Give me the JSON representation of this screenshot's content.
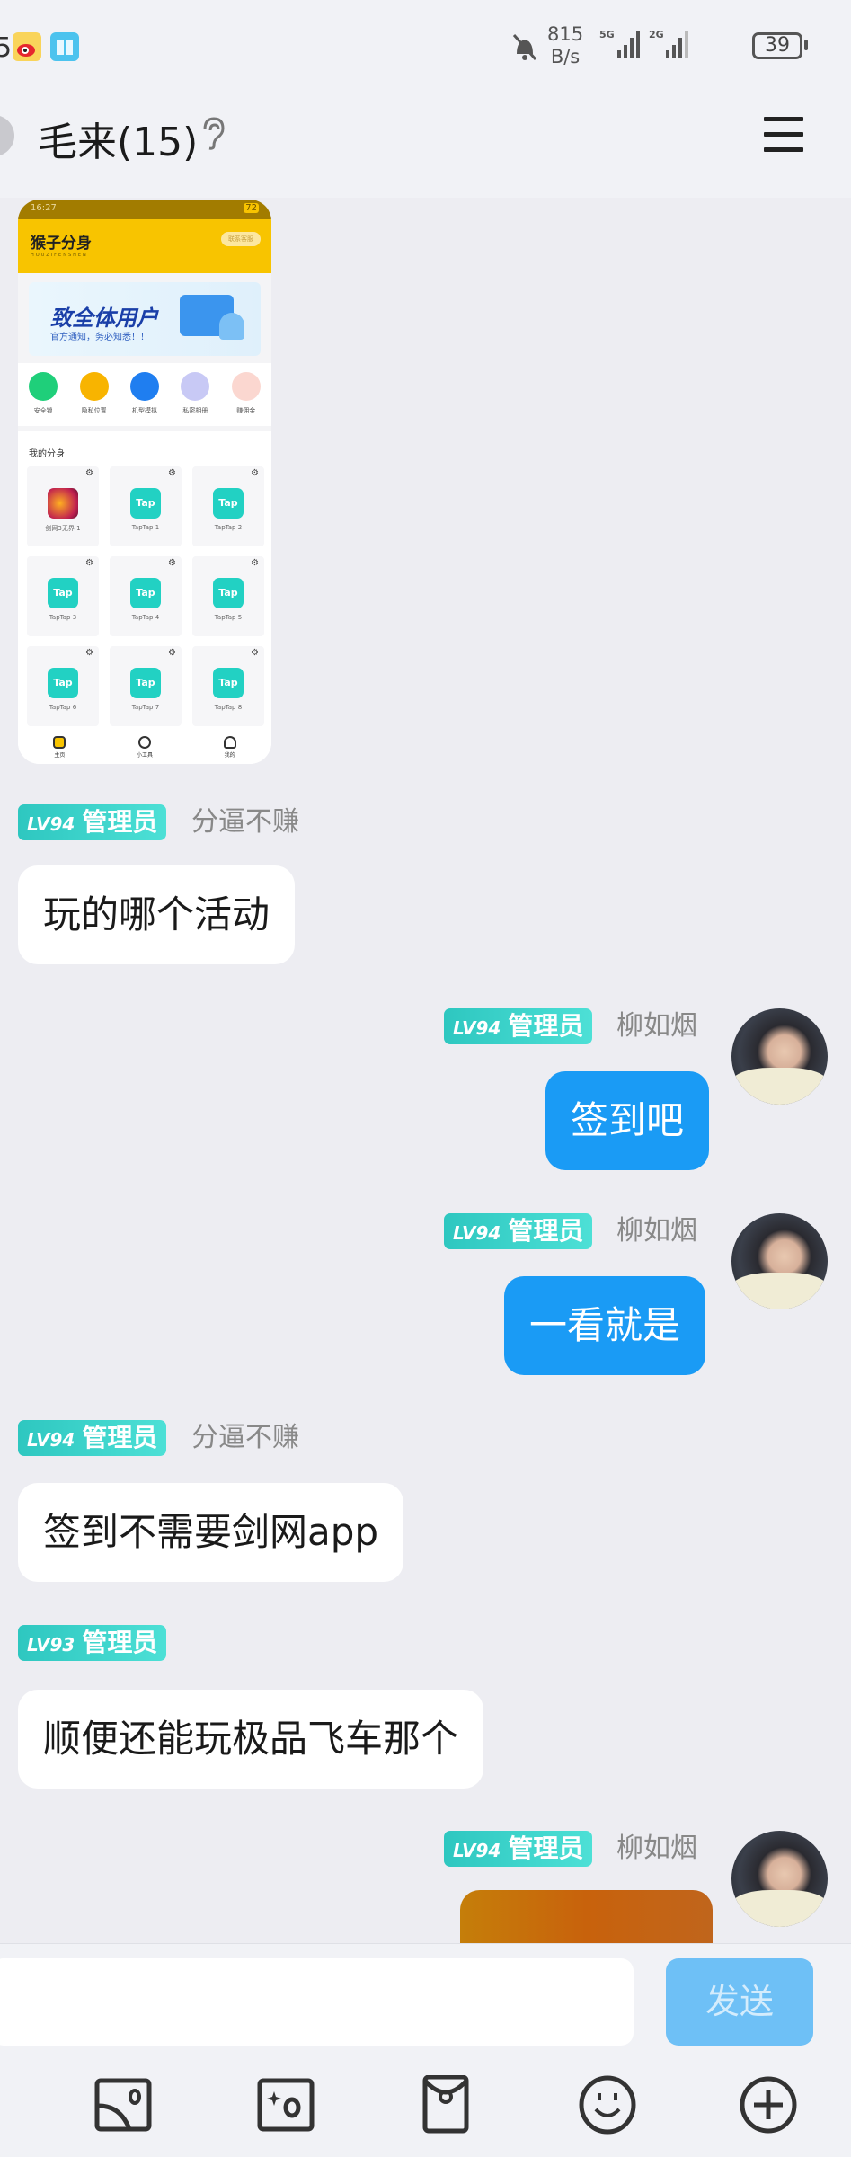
{
  "statusbar": {
    "left_icons": [
      "weibo-icon",
      "book-reader-icon"
    ],
    "net_speed_value": "815",
    "net_speed_unit": "B/s",
    "signal1_label": "5G",
    "signal2_label": "2G",
    "battery": "39",
    "mute_icon": "bell-off-icon"
  },
  "header": {
    "title": "毛来(15)",
    "ear_icon": "ear-icon",
    "menu_icon": "hamburger-menu-icon"
  },
  "shared_image": {
    "status_time": "16:27",
    "status_battery": "72",
    "app_name": "猴子分身",
    "app_name_pinyin": "HOUZIFENSHEN",
    "contact_button": "联系客服",
    "banner_title": "致全体用户",
    "banner_subtitle": "官方通知，务必知悉！！",
    "quick_actions": [
      "安全锁",
      "隐私位置",
      "机型模拟",
      "私密相册",
      "赚佣金"
    ],
    "quick_colors": [
      "#1fcf7a",
      "#f8b400",
      "#1f7ef0",
      "#8a8ff0",
      "#f06a5a"
    ],
    "section_title": "我的分身",
    "apps": [
      "剑网3无界 1",
      "TapTap 1",
      "TapTap 2",
      "TapTap 3",
      "TapTap 4",
      "TapTap 5",
      "TapTap 6",
      "TapTap 7",
      "TapTap 8"
    ],
    "app_icon_text": "Tap",
    "nav": [
      "主页",
      "小工具",
      "我的"
    ]
  },
  "messages": [
    {
      "side": "left",
      "level": "LV94",
      "role": "管理员",
      "nick": "分逼不赚",
      "text": "玩的哪个活动"
    },
    {
      "side": "right",
      "level": "LV94",
      "role": "管理员",
      "nick": "柳如烟",
      "text": "签到吧"
    },
    {
      "side": "right",
      "level": "LV94",
      "role": "管理员",
      "nick": "柳如烟",
      "text": "一看就是"
    },
    {
      "side": "left",
      "level": "LV94",
      "role": "管理员",
      "nick": "分逼不赚",
      "text": "签到不需要剑网app"
    },
    {
      "side": "left",
      "level": "LV93",
      "role": "管理员",
      "nick": "",
      "text": "顺便还能玩极品飞车那个"
    },
    {
      "side": "right",
      "level": "LV94",
      "role": "管理员",
      "nick": "柳如烟",
      "text": ""
    }
  ],
  "composer": {
    "input_value": "",
    "input_placeholder": "",
    "send_label": "发送",
    "tools": [
      "image-icon",
      "camera-icon",
      "red-packet-icon",
      "emoji-icon",
      "plus-circle-icon"
    ]
  },
  "colors": {
    "accent_blue": "#1a9bf5",
    "badge_teal": "#2ec7c0",
    "send_disabled": "#6ec0f6"
  }
}
